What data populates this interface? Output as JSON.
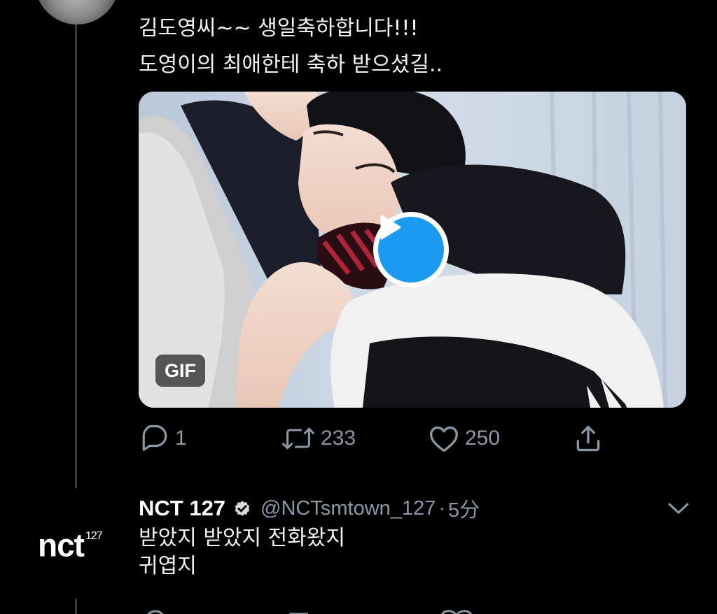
{
  "tweet": {
    "line1": "김도영씨~~ 생일축하합니다!!!",
    "line2": "도영이의 최애한테 축하 받으셨길..",
    "media": {
      "badge": "GIF",
      "play_icon": "play-icon"
    },
    "actions": {
      "reply_count": "1",
      "retweet_count": "233",
      "like_count": "250"
    }
  },
  "reply": {
    "display_name": "NCT 127",
    "handle": "@NCTsmtown_127",
    "separator": "·",
    "time": "5分",
    "avatar_logo": "nct",
    "avatar_logo_sup": "127",
    "line1": "받았지 받았지 전화왔지",
    "line2": "귀엽지"
  },
  "colors": {
    "background": "#000000",
    "secondary_text": "#8b98a5",
    "accent": "#1d9bf0"
  }
}
